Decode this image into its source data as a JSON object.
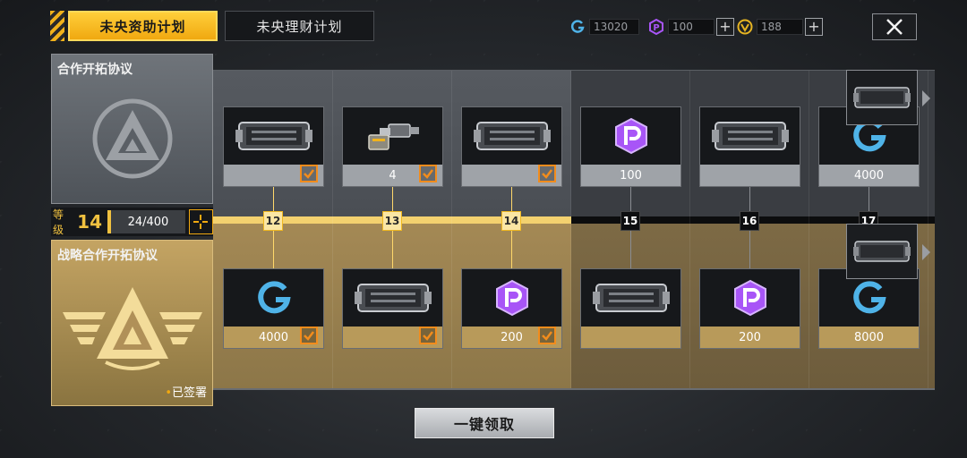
{
  "header": {
    "tabs": [
      {
        "label": "未央资助计划",
        "active": true
      },
      {
        "label": "未央理财计划",
        "active": false
      }
    ],
    "currencies": [
      {
        "icon": "g-coin-icon",
        "value": "13020",
        "has_plus": false
      },
      {
        "icon": "p-coin-icon",
        "value": "100",
        "has_plus": true
      },
      {
        "icon": "v-coin-icon",
        "value": "188",
        "has_plus": true
      }
    ],
    "plus_label": "+"
  },
  "left_panel": {
    "basic_title": "合作开拓协议",
    "premium_title": "战略合作开拓协议",
    "signed_label": "已签署",
    "level_label": "等级",
    "level": "14",
    "exp": "24/400"
  },
  "track": {
    "tiers": [
      {
        "level": "12",
        "reached": true,
        "upper": {
          "item": "weapon-crate-icon",
          "qty": "",
          "claimed": true
        },
        "lower": {
          "item": "g-coin-icon",
          "qty": "4000",
          "claimed": true
        }
      },
      {
        "level": "13",
        "reached": true,
        "upper": {
          "item": "weapon-parts-icon",
          "qty": "4",
          "claimed": true
        },
        "lower": {
          "item": "weapon-crate-icon",
          "qty": "",
          "claimed": true
        }
      },
      {
        "level": "14",
        "reached": true,
        "upper": {
          "item": "weapon-crate-icon",
          "qty": "",
          "claimed": true
        },
        "lower": {
          "item": "p-coin-icon",
          "qty": "200",
          "claimed": true
        }
      },
      {
        "level": "15",
        "reached": false,
        "upper": {
          "item": "p-coin-icon",
          "qty": "100",
          "claimed": false
        },
        "lower": {
          "item": "weapon-crate-icon",
          "qty": "",
          "claimed": false
        }
      },
      {
        "level": "16",
        "reached": false,
        "upper": {
          "item": "weapon-crate-icon",
          "qty": "",
          "claimed": false
        },
        "lower": {
          "item": "p-coin-icon",
          "qty": "200",
          "claimed": false
        }
      },
      {
        "level": "17",
        "reached": false,
        "upper": {
          "item": "g-coin-icon",
          "qty": "4000",
          "claimed": false
        },
        "lower": {
          "item": "g-coin-icon",
          "qty": "8000",
          "claimed": false
        }
      }
    ]
  },
  "footer": {
    "claim_all_label": "一键领取"
  },
  "colors": {
    "accent_gold": "#f0a810",
    "check_orange": "#f28c1c",
    "premium_gold": "#c4a463",
    "coin_purple": "#a855f7",
    "coin_blue": "#4fb3e8"
  }
}
